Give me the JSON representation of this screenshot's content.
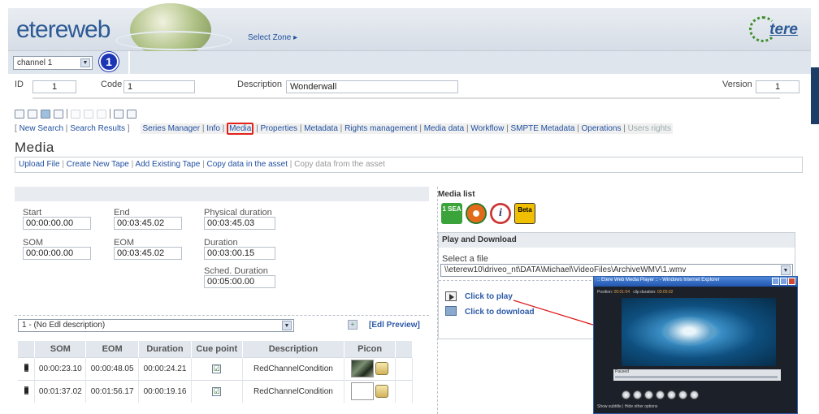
{
  "header": {
    "brand": "etereweb",
    "select_zone": "Select Zone ▸",
    "logo_text": "tere"
  },
  "channel": {
    "selected": "channel 1",
    "step_badge": "1"
  },
  "asset": {
    "id_label": "ID",
    "id_value": "1",
    "code_label": "Code",
    "code_value": "1",
    "description_label": "Description",
    "description_value": "Wonderwall",
    "version_label": "Version",
    "version_value": "1"
  },
  "nav": {
    "bracket_open": "[ ",
    "new_search": "New Search",
    "pipe": " | ",
    "search_results": "Search Results",
    "bracket_close": " ]",
    "items": [
      "Series Manager",
      "Info",
      "Media",
      "Properties",
      "Metadata",
      "Rights management",
      "Media data",
      "Workflow",
      "SMPTE Metadata",
      "Operations"
    ],
    "disabled": "Users rights"
  },
  "page_title": "Media",
  "subnav": {
    "items": [
      "Upload File",
      "Create New Tape",
      "Add Existing Tape",
      "Copy data in the asset"
    ],
    "disabled": "Copy data from the asset"
  },
  "timing": {
    "start_label": "Start",
    "start_value": "00:00:00.00",
    "end_label": "End",
    "end_value": "00:03:45.02",
    "physical_label": "Physical duration",
    "physical_value": "00:03:45.03",
    "som_label": "SOM",
    "som_value": "00:00:00.00",
    "eom_label": "EOM",
    "eom_value": "00:03:45.02",
    "duration_label": "Duration",
    "duration_value": "00:03:00.15",
    "sched_label": "Sched. Duration",
    "sched_value": "00:05:00.00"
  },
  "edl": {
    "selected": "1 - (No Edl description)",
    "preview": "[Edl Preview]"
  },
  "table": {
    "headers": [
      "SOM",
      "EOM",
      "Duration",
      "Cue point",
      "Description",
      "Picon"
    ],
    "rows": [
      {
        "som": "00:00:23.10",
        "eom": "00:00:48.05",
        "duration": "00:00:24.21",
        "cue": "☑",
        "description": "RedChannelCondition"
      },
      {
        "som": "00:01:37.02",
        "eom": "00:01:56.17",
        "duration": "00:00:19.16",
        "cue": "☑",
        "description": "RedChannelCondition"
      }
    ]
  },
  "media_list": {
    "title": "Media list",
    "icons": [
      {
        "name": "sea-icon",
        "text": "1\nSEA"
      },
      {
        "name": "media-player-icon",
        "text": ""
      },
      {
        "name": "info-icon",
        "text": "i"
      },
      {
        "name": "beta-icon",
        "text": "Beta"
      }
    ]
  },
  "play_download": {
    "title": "Play and Download",
    "select_label": "Select a file",
    "file": "\\\\eterew10\\driveo_nt\\DATA\\Michael\\VideoFiles\\ArchiveWMV\\1.wmv",
    "play": "Click to play",
    "download": "Click to download"
  },
  "popup": {
    "title": ":: Etere Web Media Player :: - Windows Internet Explorer",
    "position_label": "Position:",
    "position_value": "00:01:04",
    "clip_label": "clip duration:",
    "clip_value": "03:05:02",
    "status": "Paused",
    "footer": "Show subtitle | Hide other options"
  },
  "colors": {
    "brand": "#2d5a95",
    "link": "#1f4f9f",
    "highlight": "#e2231a"
  }
}
